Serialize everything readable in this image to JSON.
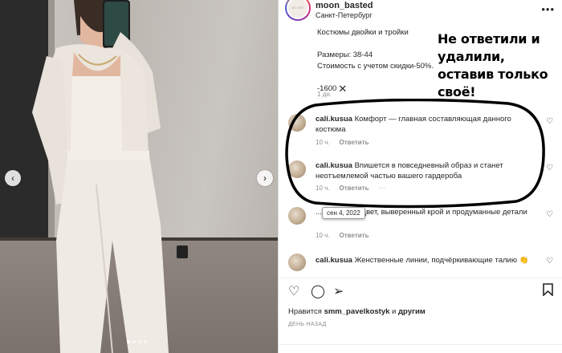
{
  "post": {
    "username": "moon_basted",
    "location": "Санкт-Петербург",
    "avatar_text": "BE HER",
    "caption_lines": [
      "Костюмы двойки и тройки",
      "Размеры: 38-44",
      "Стоимость с учетом скидки-50%."
    ],
    "caption_price": "-1600",
    "caption_time": "1 дн."
  },
  "annotation": "Не ответили и удалили, оставив только своё!",
  "comments": [
    {
      "user": "cali.kusua",
      "text": "Комфорт — главная составляющая данного костюма",
      "time": "10 ч.",
      "reply": "Ответить",
      "more": ""
    },
    {
      "user": "cali.kusua",
      "text": "Впишется в повседневный образ и станет неотъемлемой частью вашего гардероба",
      "time": "10 ч.",
      "reply": "Ответить",
      "more": "···"
    },
    {
      "user": "",
      "text": "...огородный цвет, выверенный крой и продуманные детали",
      "time": "10 ч.",
      "reply": "Ответить",
      "more": ""
    },
    {
      "user": "cali.kusua",
      "text": "Женственные линии, подчёркивающие талию",
      "time": "",
      "reply": "",
      "more": ""
    }
  ],
  "tooltip": "сен 4, 2022",
  "likes": {
    "prefix": "Нравится ",
    "user": "smm_pavelkostyk",
    "middle": " и ",
    "others": "другим"
  },
  "date_label": "ДЕНЬ НАЗАД",
  "icons": [
    "heart-icon",
    "comment-icon",
    "share-icon",
    "bookmark-icon"
  ]
}
